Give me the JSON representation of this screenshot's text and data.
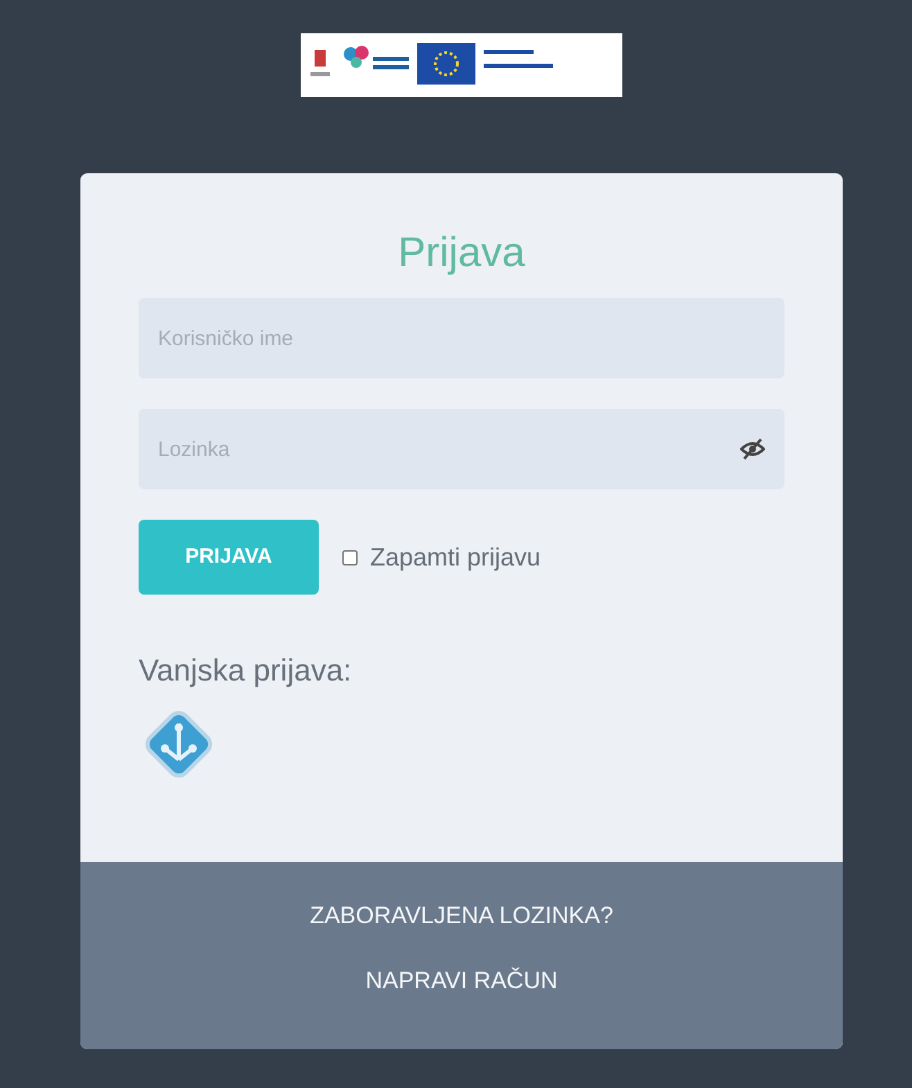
{
  "title": "Prijava",
  "fields": [
    {
      "kind": "text",
      "placeholder": "Korisničko ime"
    },
    {
      "kind": "password",
      "placeholder": "Lozinka"
    }
  ],
  "submit": "PRIJAVA",
  "remember": {
    "label": "Zapamti prijavu",
    "checked": false
  },
  "external_login": {
    "label": "Vanjska prijava:"
  },
  "footer_links": [
    "ZABORAVLJENA LOZINKA?",
    "NAPRAVI RAČUN"
  ]
}
